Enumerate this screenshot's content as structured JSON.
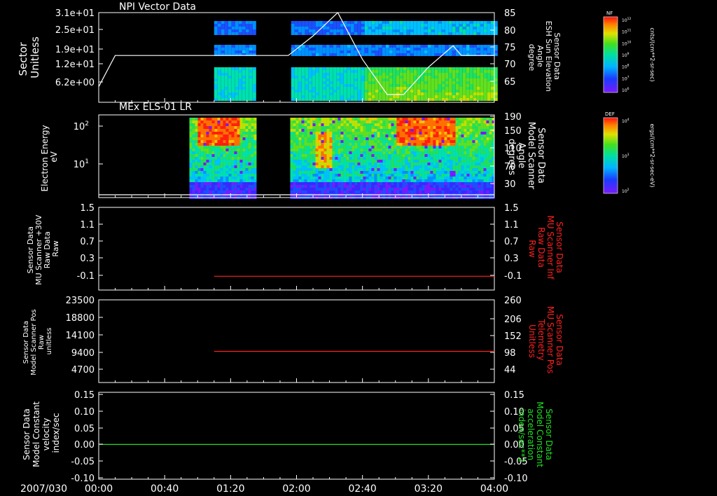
{
  "panels": [
    {
      "title": "NPI Vector Data",
      "left_label": [
        "Sector",
        "Unitless"
      ],
      "right_label": [
        "Sensor Data",
        "ESH Sun Elevation",
        "Angle",
        "degree"
      ],
      "right_label_color": "#ffffff",
      "left_ticks": [
        "3.1e+01",
        "2.5e+01",
        "1.9e+01",
        "1.2e+01",
        "6.2e+00"
      ],
      "right_ticks": [
        "85",
        "80",
        "75",
        "70",
        "65"
      ]
    },
    {
      "title": "MEx ELS-01 LR",
      "left_label": [
        "Electron Energy",
        "eV"
      ],
      "right_label": [
        "Sensor Data",
        "Model Scanner",
        "Angle",
        "degrees"
      ],
      "right_label_color": "#ffffff",
      "left_ticks": [
        "10",
        "10"
      ],
      "left_tick_exps": [
        "2",
        "1"
      ],
      "right_ticks": [
        "190",
        "150",
        "110",
        "70",
        "30"
      ]
    },
    {
      "title": "",
      "left_label": [
        "Sensor Data",
        "MU Scanner +30V",
        "Raw Data",
        "Raw"
      ],
      "right_label": [
        "Sensor Data",
        "MU Scanner Inf",
        "Raw Data",
        "Raw"
      ],
      "right_label_color": "#ff2020",
      "left_ticks": [
        "1.5",
        "1.1",
        "0.7",
        "0.3",
        "-0.1"
      ],
      "right_ticks": [
        "1.5",
        "1.1",
        "0.7",
        "0.3",
        "-0.1"
      ]
    },
    {
      "title": "",
      "left_label": [
        "Sensor Data",
        "Model Scanner Pos",
        "Raw",
        "unitless"
      ],
      "right_label": [
        "Sensor Data",
        "MU Scanner Pos",
        "Telemetry",
        "Unitless"
      ],
      "right_label_color": "#ff2020",
      "left_ticks": [
        "23500",
        "18800",
        "14100",
        "9400",
        "4700"
      ],
      "right_ticks": [
        "260",
        "206",
        "152",
        "98",
        "44"
      ]
    },
    {
      "title": "",
      "left_label": [
        "Sensor Data",
        "Model Constant",
        "velocity",
        "index/sec"
      ],
      "right_label": [
        "Sensor Data",
        "Model Constant",
        "acceleration",
        "index/sec**2"
      ],
      "right_label_color": "#20e020",
      "left_ticks": [
        "0.15",
        "0.10",
        "0.05",
        "0.00",
        "-0.05",
        "-0.10"
      ],
      "right_ticks": [
        "0.15",
        "0.10",
        "0.05",
        "0.00",
        "-0.05",
        "-0.10"
      ]
    }
  ],
  "time_axis": {
    "date_label": "2007/030",
    "tick_labels": [
      "00:00",
      "00:40",
      "01:20",
      "02:00",
      "02:40",
      "03:20",
      "04:00"
    ]
  },
  "colorbars": [
    {
      "label": "NF",
      "units": "cnts/(cm**2-sr-sec)",
      "ticks": [
        "10",
        "10",
        "10",
        "10",
        "10",
        "10",
        "10"
      ],
      "tick_exps": [
        "12",
        "11",
        "10",
        "9",
        "8",
        "7",
        "6"
      ]
    },
    {
      "label": "DEF",
      "units": "ergs/(cm**2-sr-sec-eV)",
      "ticks": [
        "10",
        "10",
        "10"
      ],
      "tick_exps": [
        "4",
        "3",
        "2"
      ]
    }
  ],
  "chart_data": [
    {
      "type": "line",
      "title": "NPI Vector Data",
      "series": [
        {
          "name": "ESH Sun Elevation Angle",
          "color": "#ffffff",
          "x": [
            "00:00",
            "00:10",
            "01:55",
            "02:10",
            "02:25",
            "02:40",
            "02:55",
            "03:05",
            "03:20",
            "03:35",
            "03:40",
            "04:00"
          ],
          "y": [
            66.0,
            74.0,
            74.0,
            79.0,
            85.0,
            73.0,
            64.0,
            64.0,
            71.0,
            76.5,
            74.0,
            74.0
          ]
        }
      ],
      "ylim_left": [
        6.2,
        31
      ],
      "ylim_right": [
        62,
        85
      ]
    },
    {
      "type": "heatmap",
      "title": "MEx ELS-01 LR",
      "series": [
        {
          "name": "Model Scanner Angle",
          "color": "#ffffff",
          "x": [
            "00:00",
            "04:00"
          ],
          "y": [
            10.0,
            10.0
          ]
        }
      ],
      "ylim_right": [
        10,
        190
      ]
    },
    {
      "type": "line",
      "series": [
        {
          "name": "MU Scanner Inf Raw Data",
          "color": "#ff2020",
          "x": [
            "01:10",
            "04:00"
          ],
          "y": [
            0.0,
            0.0
          ]
        }
      ],
      "ylim": [
        -0.3,
        1.5
      ]
    },
    {
      "type": "line",
      "series": [
        {
          "name": "MU Scanner Pos Telemetry",
          "color": "#ff2020",
          "x": [
            "01:10",
            "04:00"
          ],
          "y": [
            98,
            98
          ]
        }
      ],
      "ylim": [
        0,
        260
      ]
    },
    {
      "type": "line",
      "series": [
        {
          "name": "Model Constant acceleration",
          "color": "#20e020",
          "x": [
            "00:00",
            "04:00"
          ],
          "y": [
            0.0,
            0.0
          ]
        }
      ],
      "ylim": [
        -0.1,
        0.15
      ]
    }
  ]
}
